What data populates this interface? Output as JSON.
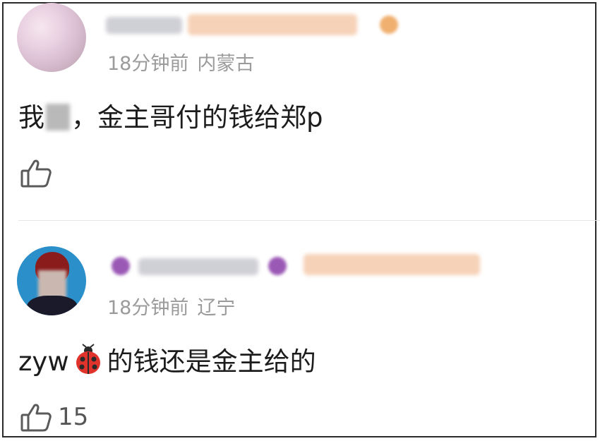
{
  "comments": [
    {
      "time": "18分钟前",
      "location": "内蒙古",
      "text_before": "我",
      "text_after": "，金主哥付的钱给郑p",
      "like_count": ""
    },
    {
      "time": "18分钟前",
      "location": "辽宁",
      "text_before": "zyw",
      "text_after": "的钱还是金主给的",
      "like_count": "15"
    }
  ],
  "icons": {
    "like": "thumbs-up-icon",
    "emoji": "ladybug-icon"
  },
  "colors": {
    "meta_text": "#9b9b9b",
    "content_text": "#1c1c1c",
    "divider": "#e6e6e6"
  }
}
